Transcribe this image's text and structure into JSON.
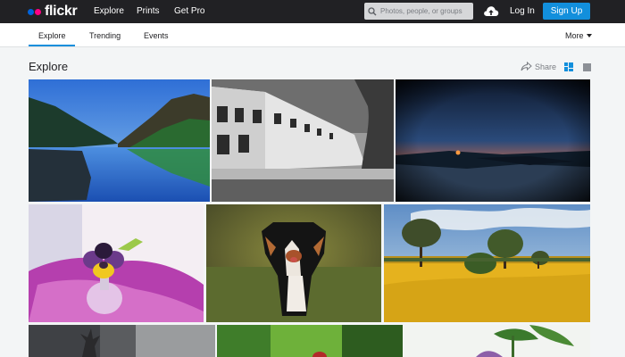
{
  "brand": {
    "name": "flickr"
  },
  "nav": {
    "explore": "Explore",
    "prints": "Prints",
    "get_pro": "Get Pro"
  },
  "search": {
    "placeholder": "Photos, people, or groups"
  },
  "account": {
    "login": "Log In",
    "signup": "Sign Up"
  },
  "subnav": {
    "tabs": [
      "Explore",
      "Trending",
      "Events"
    ],
    "more": "More"
  },
  "page": {
    "title": "Explore",
    "share": "Share"
  },
  "photos": [
    {
      "subject": "mountain lake"
    },
    {
      "subject": "black and white row houses"
    },
    {
      "subject": "sunset over lake"
    },
    {
      "subject": "pansy flower in glass"
    },
    {
      "subject": "dog running"
    },
    {
      "subject": "trees in yellow field"
    },
    {
      "subject": "dark tree"
    },
    {
      "subject": "green blur"
    },
    {
      "subject": "flowers"
    }
  ]
}
